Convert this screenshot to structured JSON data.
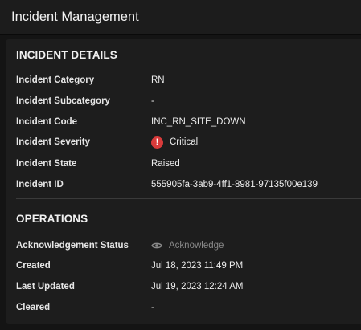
{
  "header": {
    "title": "Incident Management"
  },
  "details": {
    "section_title": "INCIDENT DETAILS",
    "rows": [
      {
        "label": "Incident Category",
        "value": "RN"
      },
      {
        "label": "Incident Subcategory",
        "value": "-"
      },
      {
        "label": "Incident Code",
        "value": "INC_RN_SITE_DOWN"
      },
      {
        "label": "Incident Severity",
        "value": "Critical"
      },
      {
        "label": "Incident State",
        "value": "Raised"
      },
      {
        "label": "Incident ID",
        "value": "555905fa-3ab9-4ff1-8981-97135f00e139"
      }
    ]
  },
  "operations": {
    "section_title": "OPERATIONS",
    "rows": [
      {
        "label": "Acknowledgement Status",
        "value": "Acknowledge"
      },
      {
        "label": "Created",
        "value": "Jul 18, 2023 11:49 PM"
      },
      {
        "label": "Last Updated",
        "value": "Jul 19, 2023 12:24 AM"
      },
      {
        "label": "Cleared",
        "value": "-"
      }
    ]
  },
  "colors": {
    "background": "#141414",
    "card": "#1d1d1d",
    "critical": "#d93b3b",
    "muted": "#8a8a8a"
  },
  "icons": {
    "severity": "exclamation-circle-icon",
    "acknowledge": "eye-icon"
  }
}
